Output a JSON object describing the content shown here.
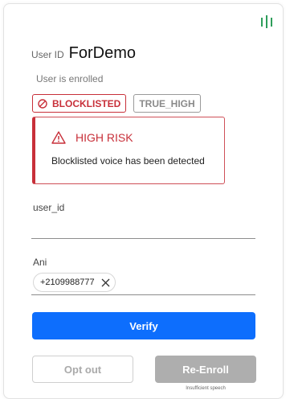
{
  "header": {
    "user_id_label": "User ID",
    "user_id_value": "ForDemo",
    "enrollment_status": "User is enrolled"
  },
  "tags": {
    "blocklisted": "BLOCKLISTED",
    "risk_level": "TRUE_HIGH"
  },
  "alert": {
    "title": "HIGH RISK",
    "message": "Blocklisted voice has been detected"
  },
  "form": {
    "user_id_label": "user_id",
    "user_id_value": "",
    "ani_label": "Ani",
    "ani_chip": "+2109988777"
  },
  "buttons": {
    "verify": "Verify",
    "opt_out": "Opt out",
    "re_enroll": "Re-Enroll",
    "re_enroll_hint": "Insufficient speech"
  },
  "colors": {
    "primary": "#0d6efd",
    "danger": "#c8303a",
    "accent_green": "#2e9e5b"
  },
  "icons": {
    "top_right": "bars-icon",
    "block": "block-icon",
    "warning": "warning-icon",
    "chip_close": "close-icon"
  }
}
